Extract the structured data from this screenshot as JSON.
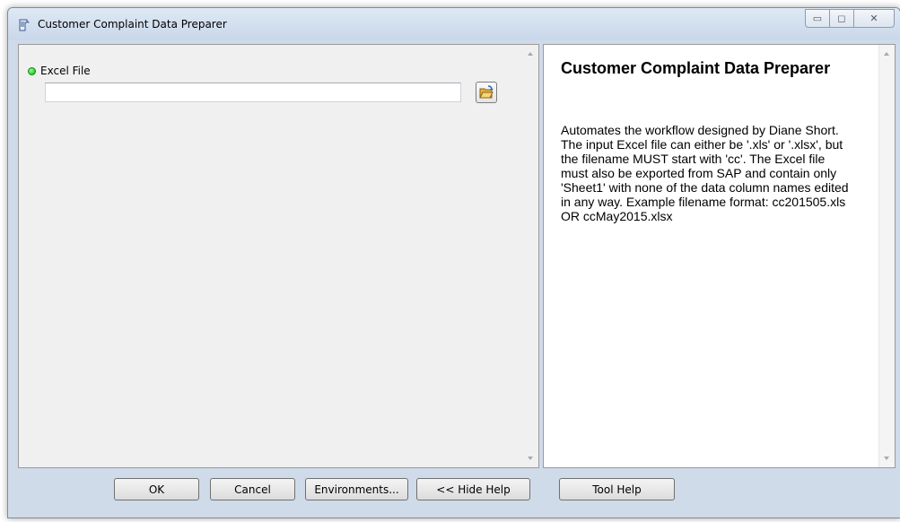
{
  "window": {
    "title": "Customer Complaint Data Preparer",
    "caption_buttons": {
      "minimize": "▭",
      "maximize": "◻",
      "close": "✕"
    }
  },
  "parameters": {
    "excel_file": {
      "label": "Excel File",
      "value": "",
      "required": true
    }
  },
  "help": {
    "title": "Customer Complaint Data Preparer",
    "body": "Automates the workflow designed by Diane Short. The input Excel file can either be '.xls' or '.xlsx', but the filename MUST start with 'cc'. The Excel file must also be exported from SAP and contain only 'Sheet1' with none of the data column names edited in any way. Example filename format: cc201505.xls OR ccMay2015.xlsx"
  },
  "buttons": {
    "ok": "OK",
    "cancel": "Cancel",
    "environments": "Environments...",
    "hide_help": "<< Hide Help",
    "tool_help": "Tool Help"
  },
  "colors": {
    "required_indicator": "#10b010",
    "titlebar": "#cfdbe9"
  }
}
